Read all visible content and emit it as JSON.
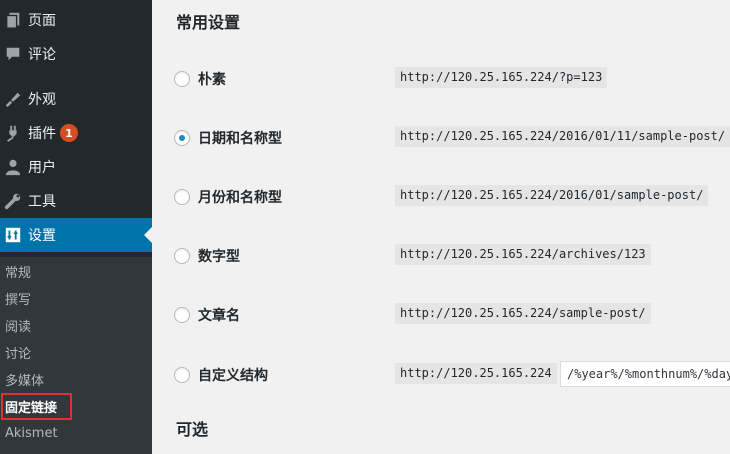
{
  "sidebar": {
    "items": [
      {
        "label": "页面",
        "icon": "pages-icon"
      },
      {
        "label": "评论",
        "icon": "comments-icon"
      },
      {
        "label": "外观",
        "icon": "appearance-icon"
      },
      {
        "label": "插件",
        "icon": "plugins-icon",
        "badge": "1"
      },
      {
        "label": "用户",
        "icon": "users-icon"
      },
      {
        "label": "工具",
        "icon": "tools-icon"
      },
      {
        "label": "设置",
        "icon": "settings-icon",
        "active": true
      }
    ],
    "submenu": [
      {
        "label": "常规"
      },
      {
        "label": "撰写"
      },
      {
        "label": "阅读"
      },
      {
        "label": "讨论"
      },
      {
        "label": "多媒体"
      },
      {
        "label": "固定链接",
        "current": true
      },
      {
        "label": "Akismet"
      }
    ]
  },
  "main": {
    "common_settings_title": "常用设置",
    "options": [
      {
        "label": "朴素",
        "url": "http://120.25.165.224/?p=123",
        "checked": false
      },
      {
        "label": "日期和名称型",
        "url": "http://120.25.165.224/2016/01/11/sample-post/",
        "checked": true
      },
      {
        "label": "月份和名称型",
        "url": "http://120.25.165.224/2016/01/sample-post/",
        "checked": false
      },
      {
        "label": "数字型",
        "url": "http://120.25.165.224/archives/123",
        "checked": false
      },
      {
        "label": "文章名",
        "url": "http://120.25.165.224/sample-post/",
        "checked": false
      },
      {
        "label": "自定义结构",
        "url": "http://120.25.165.224",
        "checked": false,
        "input_value": "/%year%/%monthnum%/%day%/%postname%/"
      }
    ],
    "optional_title": "可选"
  },
  "colors": {
    "sidebar_bg": "#23282d",
    "submenu_bg": "#32373c",
    "active_bg": "#0073aa",
    "badge_bg": "#d54e21",
    "highlight_border": "#e03131"
  }
}
